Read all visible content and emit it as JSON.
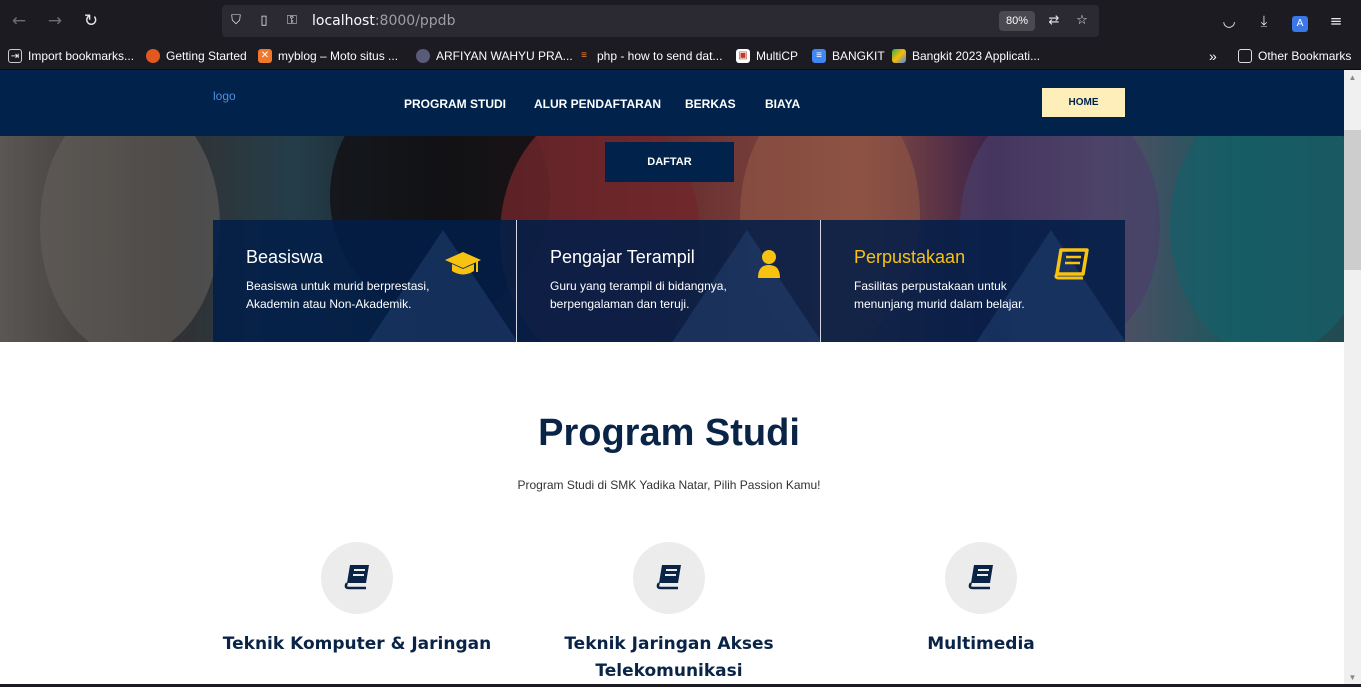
{
  "browser": {
    "url_host": "localhost",
    "url_rest": ":8000/ppdb",
    "zoom": "80%",
    "bookmarks": [
      {
        "label": "Import bookmarks...",
        "color": "#1c1b22"
      },
      {
        "label": "Getting Started",
        "color": "#e25920"
      },
      {
        "label": "myblog – Moto situs ...",
        "color": "#f0782a"
      },
      {
        "label": "ARFIYAN WAHYU PRA...",
        "color": "#5a5a7a"
      },
      {
        "label": "php - how to send dat...",
        "color": "#f48024"
      },
      {
        "label": "MultiCP",
        "color": "#c0392b"
      },
      {
        "label": "BANGKIT",
        "color": "#4285f4"
      },
      {
        "label": "Bangkit 2023 Applicati...",
        "color": "#34a853"
      }
    ],
    "other_bookmarks": "Other Bookmarks"
  },
  "site": {
    "logo": "logo",
    "menu": [
      "PROGRAM STUDI",
      "ALUR PENDAFTARAN",
      "BERKAS",
      "BIAYA"
    ],
    "home_button": "HOME",
    "daftar_button": "DAFTAR"
  },
  "features": [
    {
      "title": "Beasiswa",
      "text": "Beasiswa untuk murid berprestasi, Akademin atau Non-Akademik.",
      "icon": "graduation-cap-icon"
    },
    {
      "title": "Pengajar Terampil",
      "text": "Guru yang terampil di bidangnya, berpengalaman dan teruji.",
      "icon": "user-icon"
    },
    {
      "title": "Perpustakaan",
      "text": "Fasilitas perpustakaan untuk menunjang murid dalam belajar.",
      "icon": "book-icon"
    }
  ],
  "program_studi": {
    "title": "Program Studi",
    "subtitle": "Program Studi di SMK Yadika Natar, Pilih Passion Kamu!",
    "items": [
      {
        "name": "Teknik Komputer & Jaringan",
        "icon": "book-icon"
      },
      {
        "name": "Teknik Jaringan Akses Telekomunikasi",
        "icon": "book-icon"
      },
      {
        "name": "Multimedia",
        "icon": "book-icon"
      }
    ]
  },
  "colors": {
    "navy": "#01234b",
    "gold": "#f8c211",
    "home_bg": "#fdeeba"
  }
}
